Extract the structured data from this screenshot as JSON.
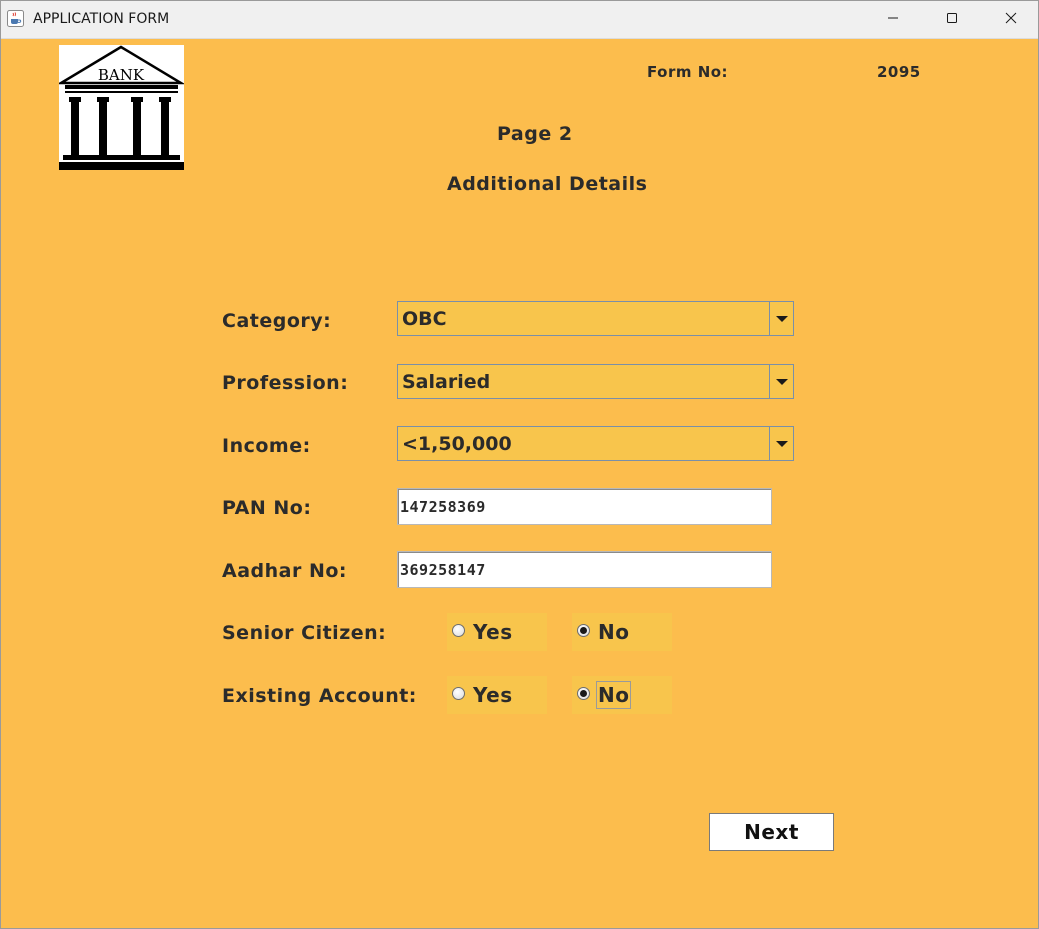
{
  "window": {
    "title": "APPLICATION FORM",
    "icon": "java-cup-icon",
    "controls": [
      "minimize-icon",
      "maximize-icon",
      "close-icon"
    ]
  },
  "header": {
    "logo_text": "BANK",
    "form_no_label": "Form No:",
    "form_no_value": "2095",
    "page_title": "Page 2",
    "section_title": "Additional Details"
  },
  "fields": {
    "category": {
      "label": "Category:",
      "value": "OBC"
    },
    "profession": {
      "label": "Profession:",
      "value": "Salaried"
    },
    "income": {
      "label": "Income:",
      "value": "<1,50,000"
    },
    "pan": {
      "label": "PAN No:",
      "value": "147258369"
    },
    "aadhar": {
      "label": "Aadhar No:",
      "value": "369258147"
    },
    "senior_citizen": {
      "label": "Senior Citizen:",
      "options": [
        {
          "label": "Yes",
          "checked": false
        },
        {
          "label": "No",
          "checked": true
        }
      ]
    },
    "existing_account": {
      "label": "Existing Account:",
      "options": [
        {
          "label": "Yes",
          "checked": false
        },
        {
          "label": "No",
          "checked": true
        }
      ]
    }
  },
  "actions": {
    "next_label": "Next"
  },
  "colors": {
    "background": "#fcbd4d",
    "field_background": "#f8c54c",
    "text": "#2b2b2b"
  }
}
